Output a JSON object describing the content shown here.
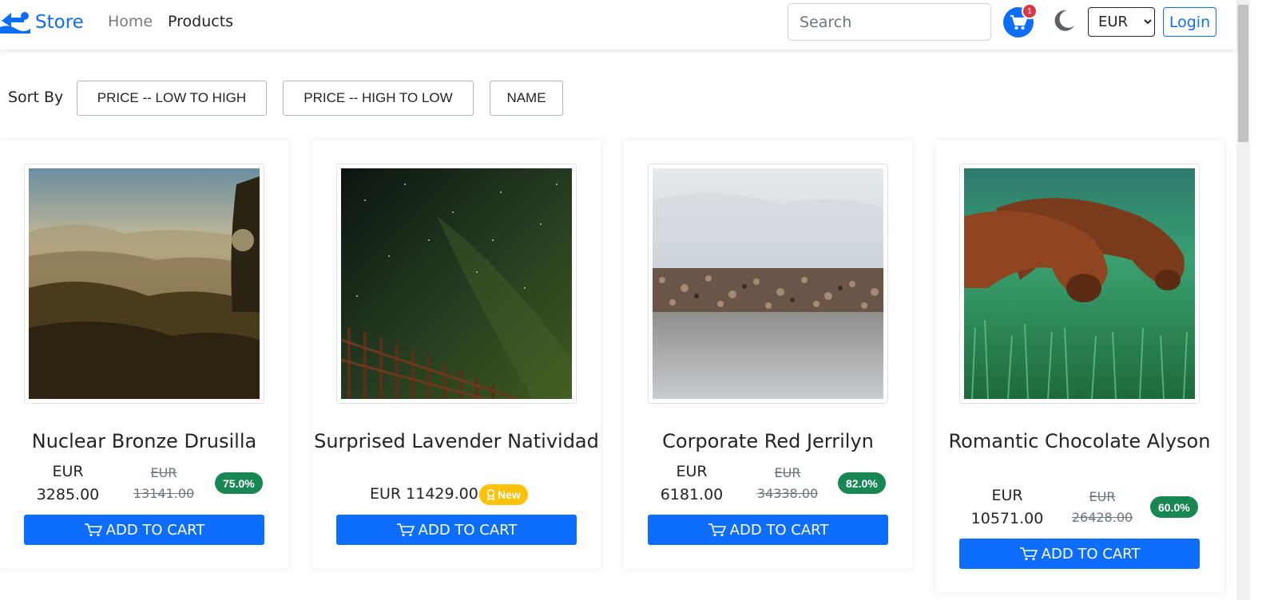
{
  "navbar": {
    "brand": "Store",
    "links": [
      "Home",
      "Products"
    ],
    "search_placeholder": "Search",
    "cart_count": "1",
    "currency": "EUR",
    "currency_options": [
      "EUR"
    ],
    "login": "Login",
    "icons": {
      "logo": "store-logo-icon",
      "cart": "cart-icon",
      "theme": "moon-icon"
    }
  },
  "sort": {
    "label": "Sort By",
    "options": [
      "PRICE -- LOW TO HIGH",
      "PRICE -- HIGH TO LOW",
      "NAME"
    ]
  },
  "add_to_cart_label": "ADD TO CART",
  "products": [
    {
      "title": "Nuclear Bronze Drusilla",
      "currency": "EUR",
      "price": "3285.00",
      "old_price": "EUR 13141.00",
      "discount": "75.0%",
      "image": "misty-hills-landscape"
    },
    {
      "title": "Surprised Lavender Natividad",
      "price": "EUR 11429.00",
      "badge": "New",
      "image": "night-sky-fence"
    },
    {
      "title": "Corporate Red Jerrilyn",
      "currency": "EUR",
      "price": "6181.00",
      "old_price": "EUR 34338.00",
      "discount": "82.0%",
      "image": "rocky-shore-water"
    },
    {
      "title": "Romantic Chocolate Alyson",
      "currency": "EUR",
      "price": "10571.00",
      "old_price": "EUR 26428.00",
      "discount": "60.0%",
      "image": "dogs-on-grass"
    }
  ],
  "colors": {
    "primary": "#0d6efd",
    "success": "#198754",
    "warning": "#ffc107",
    "danger": "#dc3545"
  }
}
